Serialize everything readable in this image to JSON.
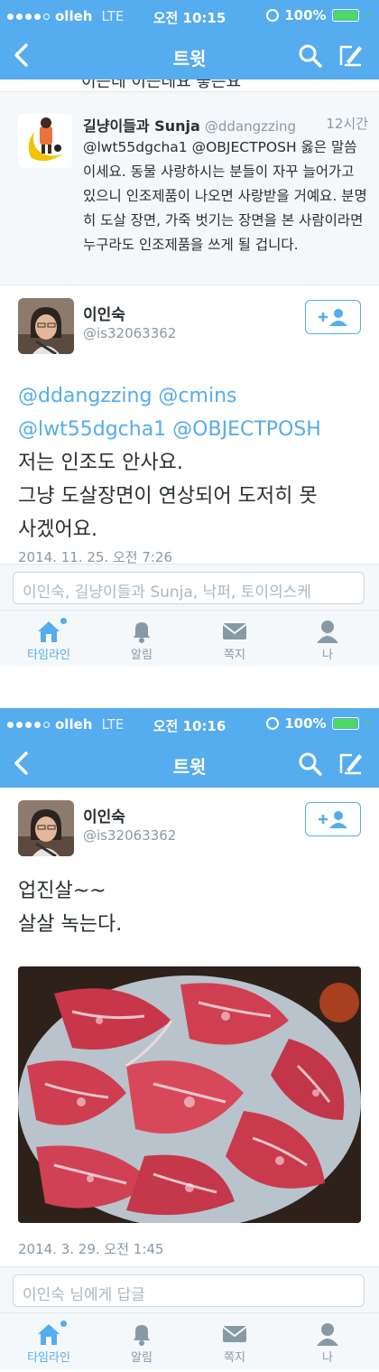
{
  "colors": {
    "accent": "#55acee",
    "nav_bg": "#55acee",
    "text": "#292f33",
    "muted": "#8899a6",
    "battery": "#4cd964"
  },
  "screen1": {
    "status": {
      "carrier": "olleh",
      "network": "LTE",
      "time": "오전 10:15",
      "battery": "100%"
    },
    "nav": {
      "title": "트윗",
      "back_icon": "back-chevron-icon",
      "search_icon": "search-icon",
      "compose_icon": "compose-icon"
    },
    "cut_text": "이는데 이는데요 좋은요",
    "reply_tweet": {
      "name": "길냥이들과 Sunja",
      "handle": "@ddangzzing",
      "ago": "12시간",
      "body": "@lwt55dgcha1 @OBJECTPOSH 옳은 말씀이세요. 동물 사랑하시는 분들이 자꾸 늘어가고 있으니 인조제품이 나오면 사랑받을 거예요. 분명히 도살 장면, 가죽 벗기는 장면을 본 사람이라면 누구라도 인조제품을 쓰게 될 겁니다."
    },
    "user": {
      "name": "이인숙",
      "handle": "@is32063362"
    },
    "tweet": {
      "mentions_line1": "@ddangzzing @cmins",
      "mentions_line2": "@lwt55dgcha1 @OBJECTPOSH",
      "line1": "저는 인조도 안사요.",
      "line2": "그냥 도살장면이 연상되어 도저히 못",
      "line3": "사겠어요.",
      "date_cut": "2014. 11. 25. 오전 7:26"
    },
    "reply_placeholder": "이인숙, 길냥이들과 Sunja, 낙퍼, 토이의스케"
  },
  "screen2": {
    "status": {
      "carrier": "olleh",
      "network": "LTE",
      "time": "오전 10:16",
      "battery": "100%"
    },
    "nav": {
      "title": "트윗"
    },
    "user": {
      "name": "이인숙",
      "handle": "@is32063362"
    },
    "tweet": {
      "line1": "업진살~~",
      "line2": "살살 녹는다.",
      "date": "2014. 3. 29. 오전 1:45"
    },
    "reply_placeholder": "이인숙 님에게 답글"
  },
  "tabs": [
    {
      "label": "타임라인",
      "icon": "home-icon",
      "active": true
    },
    {
      "label": "알림",
      "icon": "bell-icon",
      "active": false
    },
    {
      "label": "쪽지",
      "icon": "envelope-icon",
      "active": false
    },
    {
      "label": "나",
      "icon": "person-icon",
      "active": false
    }
  ]
}
